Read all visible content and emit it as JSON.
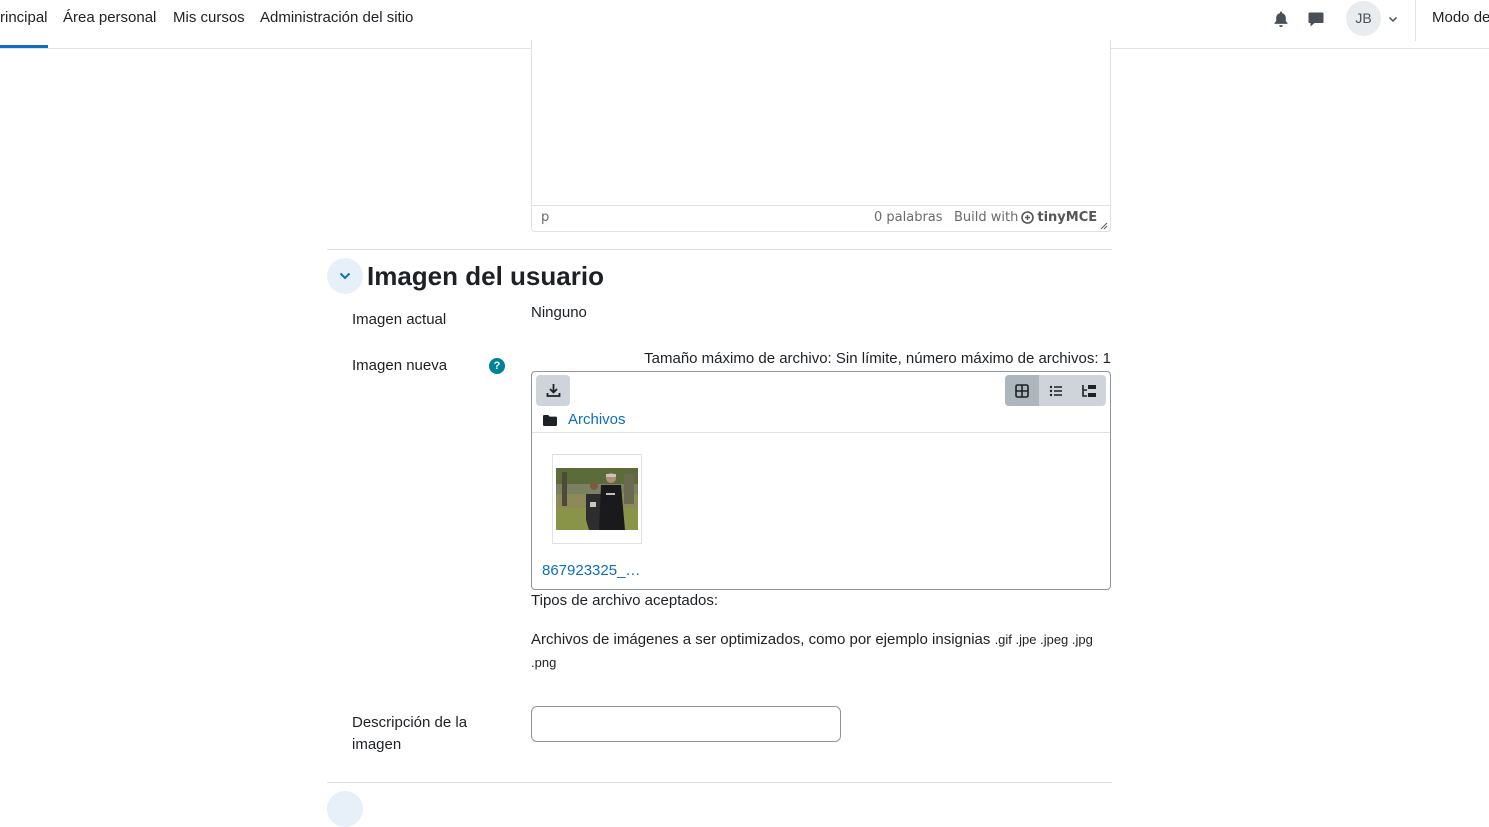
{
  "nav": {
    "items": [
      "rincipal",
      "Área personal",
      "Mis cursos",
      "Administración del sitio"
    ],
    "avatar_initials": "JB",
    "edit_mode_label": "Modo de",
    "accent_color": "#0f6cbf"
  },
  "editor": {
    "path": "p",
    "word_count": "0 palabras",
    "brand_prefix": "Build with",
    "brand_name": "tinyMCE"
  },
  "section": {
    "title": "Imagen del usuario",
    "current_image_label": "Imagen actual",
    "current_image_value": "Ninguno",
    "new_image_label": "Imagen nueva",
    "file_limits": "Tamaño máximo de archivo: Sin límite, número máximo de archivos: 1",
    "accepted_types_label": "Tipos de archivo aceptados:",
    "accepted_types_desc": "Archivos de imágenes a ser optimizados, como por ejemplo insignias",
    "accepted_extensions_line1": ".gif .jpe .jpeg .jpg",
    "accepted_extensions_line2": ".png",
    "description_label": "Descripción de la imagen",
    "description_value": ""
  },
  "filepicker": {
    "folder_label": "Archivos",
    "file_name": "867923325_…",
    "views": [
      "grid-view-icon",
      "list-view-icon",
      "tree-view-icon"
    ],
    "active_view": "grid-view-icon"
  }
}
